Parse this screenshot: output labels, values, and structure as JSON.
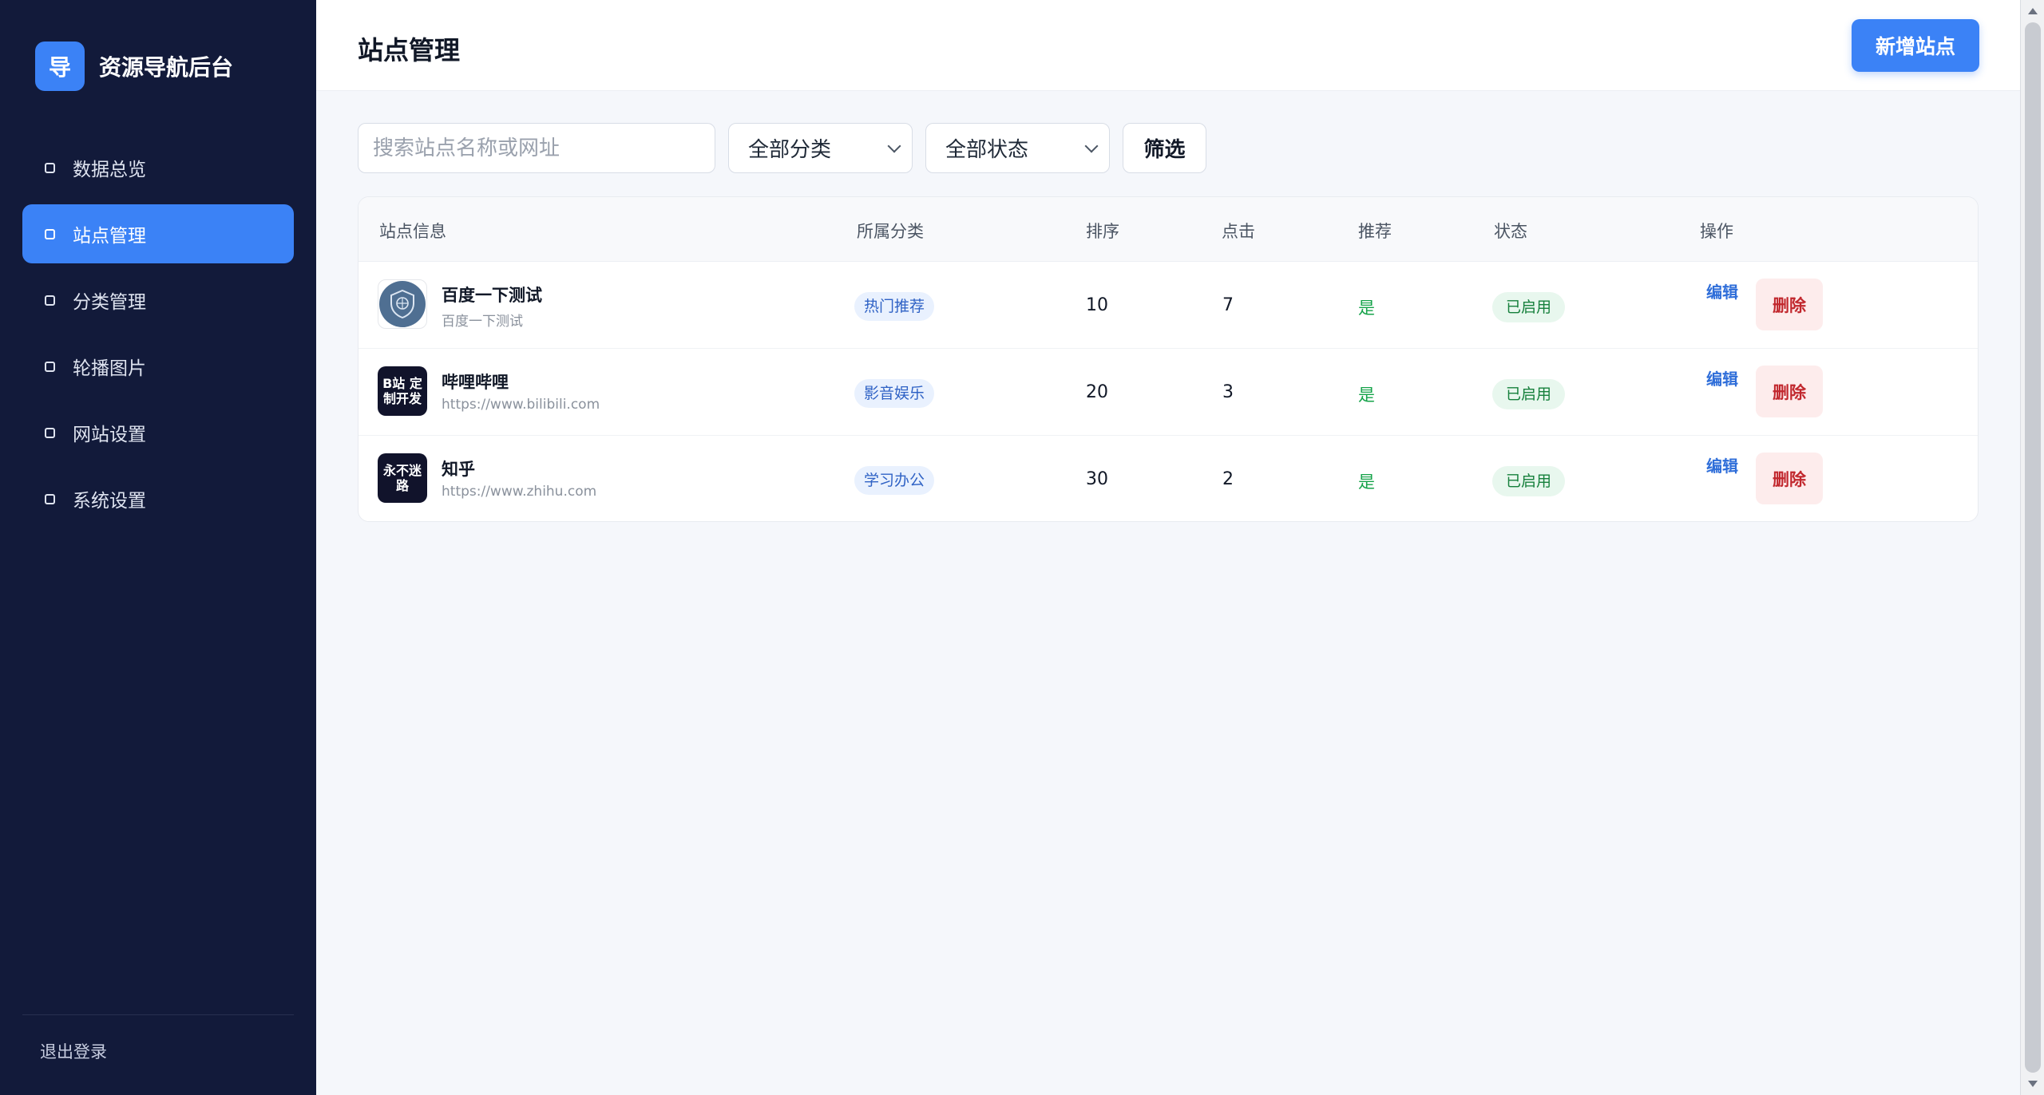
{
  "brand": {
    "logo_char": "导",
    "name": "资源导航后台"
  },
  "sidebar": {
    "items": [
      {
        "label": "数据总览",
        "active": false
      },
      {
        "label": "站点管理",
        "active": true
      },
      {
        "label": "分类管理",
        "active": false
      },
      {
        "label": "轮播图片",
        "active": false
      },
      {
        "label": "网站设置",
        "active": false
      },
      {
        "label": "系统设置",
        "active": false
      }
    ],
    "logout_label": "退出登录"
  },
  "header": {
    "title": "站点管理",
    "add_button": "新增站点"
  },
  "filters": {
    "search_placeholder": "搜索站点名称或网址",
    "category_selected": "全部分类",
    "status_selected": "全部状态",
    "filter_button": "筛选"
  },
  "table": {
    "columns": [
      "站点信息",
      "所属分类",
      "排序",
      "点击",
      "推荐",
      "状态",
      "操作"
    ],
    "rows": [
      {
        "name": "百度一下测试",
        "sub": "百度一下测试",
        "category": "热门推荐",
        "order": "10",
        "clicks": "7",
        "recommended": "是",
        "status": "已启用",
        "edit": "编辑",
        "delete": "删除",
        "logo": "shield-logo",
        "logo_text": ""
      },
      {
        "name": "哔哩哔哩",
        "sub": "https://www.bilibili.com",
        "category": "影音娱乐",
        "order": "20",
        "clicks": "3",
        "recommended": "是",
        "status": "已启用",
        "edit": "编辑",
        "delete": "删除",
        "logo": "bilibili-logo",
        "logo_text": "B站 定制开发"
      },
      {
        "name": "知乎",
        "sub": "https://www.zhihu.com",
        "category": "学习办公",
        "order": "30",
        "clicks": "2",
        "recommended": "是",
        "status": "已启用",
        "edit": "编辑",
        "delete": "删除",
        "logo": "zhihu-logo",
        "logo_text": "永不迷路"
      }
    ]
  },
  "colors": {
    "sidebar_bg": "#121a3a",
    "accent": "#3b82f6",
    "success": "#16a34a",
    "danger": "#c1272d"
  }
}
